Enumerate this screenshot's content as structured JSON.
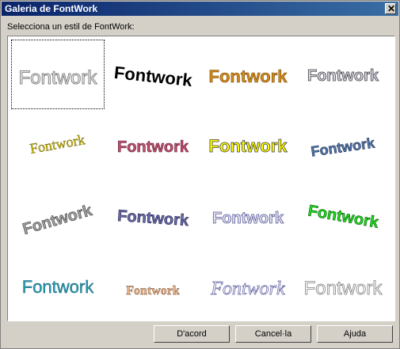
{
  "dialog": {
    "title": "Galeria de FontWork",
    "prompt": "Selecciona un estil de FontWork:"
  },
  "gallery": {
    "style_text": "Fontwork",
    "selected_index": 0
  },
  "buttons": {
    "ok": "D'acord",
    "cancel": "Cancel·la",
    "help": "Ajuda"
  }
}
